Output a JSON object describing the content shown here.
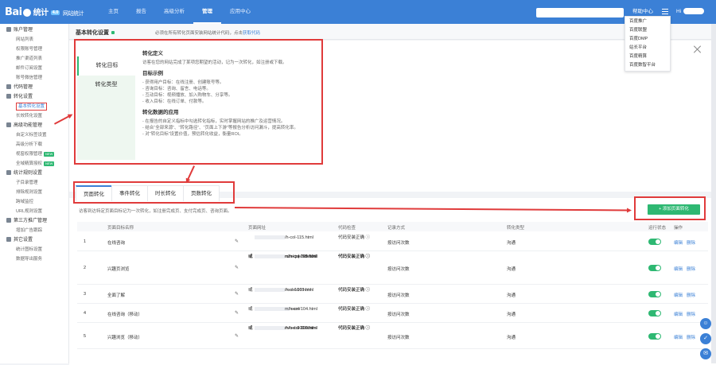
{
  "header": {
    "logo": {
      "brand": "Bai",
      "cn": "统计",
      "tag": "4.0",
      "subtitle": "网站统计"
    },
    "nav": [
      "主页",
      "报告",
      "高级分析",
      "管理",
      "应用中心"
    ],
    "active_nav": "管理",
    "help": "帮助中心",
    "greeting": "Hi"
  },
  "help_menu": [
    "百度推广",
    "百度联盟",
    "百度DMP",
    "站长平台",
    "百度精算",
    "百度数智平台"
  ],
  "sidebar": [
    {
      "group": "账户管理",
      "icon": "user-icon",
      "items": [
        {
          "label": "网站列表"
        },
        {
          "label": "权限账号管理"
        },
        {
          "label": "推广渠道列表"
        },
        {
          "label": "邮件订阅设置"
        },
        {
          "label": "账号微信管理"
        }
      ]
    },
    {
      "group": "代码管理",
      "icon": "code-icon",
      "items": []
    },
    {
      "group": "转化设置",
      "icon": "funnel-icon",
      "items": [
        {
          "label": "基本转化设置",
          "active": true
        },
        {
          "label": "长效转化设置"
        }
      ]
    },
    {
      "group": "高级功能管理",
      "icon": "settings-icon",
      "items": [
        {
          "label": "自定义标签设置"
        },
        {
          "label": "高级分析下载"
        },
        {
          "label": "视窗权限管理",
          "badge": "NEW"
        },
        {
          "label": "全域精算授权",
          "badge": "NEW"
        }
      ]
    },
    {
      "group": "统计规则设置",
      "icon": "rules-icon",
      "items": [
        {
          "label": "子目录管理"
        },
        {
          "label": "排除规则设置"
        },
        {
          "label": "跨域监控"
        },
        {
          "label": "URL规则设置"
        }
      ]
    },
    {
      "group": "第三方推广管理",
      "icon": "promo-icon",
      "items": [
        {
          "label": "增加广告跟踪"
        }
      ]
    },
    {
      "group": "其它设置",
      "icon": "other-icon",
      "items": [
        {
          "label": "统计图标设置"
        },
        {
          "label": "数据导出服务"
        }
      ]
    }
  ],
  "page": {
    "title": "基本转化设置",
    "hint": "必须在所有转化页面安装网站统计代码，点击",
    "hint_link": "获取代码"
  },
  "info_tabs": [
    "转化目标",
    "转化类型"
  ],
  "info": {
    "h1": "转化定义",
    "p1": "访客在您的网站完成了某项您期望的活动，记为一次转化，如注册或下载。",
    "h2": "目标示例",
    "examples": [
      "- 获得用户目标：在线注册、创建账号等。",
      "- 咨询目标：咨询、留言、电话等。",
      "- 互动目标：视频播放、加入购物车、分享等。",
      "- 收入目标：在线订单、付款等。"
    ],
    "h3": "转化数据的应用",
    "apps": [
      "- 在报告的自定义指标中勾选转化指标，实时掌握网站的推广及运营情况。",
      "- 结合“全部来源”、“转化路径”、“页面上下游”等报告分析访问漏斗，提高转化率。",
      "- 对“转化目标”设置价值，预估转化收益，衡量ROI。"
    ]
  },
  "conv_tabs": [
    "页面转化",
    "事件转化",
    "时长转化",
    "页数转化"
  ],
  "conv_desc": "访客到达特定页面目标记为一次转化，如注册完成页、支付完成页、咨询页面。",
  "add_button": "+ 添加页面转化",
  "table": {
    "headers": [
      "页面目标名称",
      "页面网址",
      "代码检查",
      "记录方式",
      "转化类型",
      "运行状态",
      "操作"
    ],
    "rows": [
      {
        "idx": "1",
        "name": "在线咨询",
        "urls": [
          "/h-col-115.html"
        ],
        "checks": [
          "代码安装正确"
        ],
        "mode": "按访问次数",
        "type": "沟通"
      },
      {
        "idx": "2",
        "name": "兴趣页浏览",
        "urls": [
          "m/h-col-119.html",
          "n/col.jsp?id=107",
          "m/h-col-121.html",
          "m/h-col-105.html"
        ],
        "prefixes": [
          "",
          "或",
          "或",
          "或"
        ],
        "checks": [
          "代码安装正确",
          "代码安装正确",
          "代码安装正确",
          "代码安装正确"
        ],
        "mode": "按访问次数",
        "type": "沟通"
      },
      {
        "idx": "3",
        "name": "全面了解",
        "urls": [
          "/h-col-105.html",
          "/-col-106.html"
        ],
        "prefixes": [
          "",
          "或"
        ],
        "checks": [
          "代码安装正确",
          "代码安装正确"
        ],
        "mode": "按访问次数",
        "type": "沟通"
      },
      {
        "idx": "4",
        "name": "在线咨询（移动）",
        "urls": [
          ".com/",
          "m/h-col-104.html"
        ],
        "prefixes": [
          "",
          "或"
        ],
        "checks": [
          "代码安装正确",
          "代码安装正确"
        ],
        "mode": "按访问次数",
        "type": "沟通"
      },
      {
        "idx": "5",
        "name": "兴趣浏览（移动）",
        "urls": [
          "m/h-col-109.html",
          "m/h-col-110.html",
          "/h-col-106.html"
        ],
        "prefixes": [
          "",
          "或",
          "或"
        ],
        "checks": [
          "代码安装正确",
          "代码安装正确",
          "代码安装正确"
        ],
        "mode": "按访问次数",
        "type": "沟通"
      }
    ],
    "actions": [
      "编辑",
      "删除"
    ]
  },
  "colors": {
    "brand": "#3b80d6",
    "green": "#2eb872",
    "annotation": "#e03b3b"
  }
}
